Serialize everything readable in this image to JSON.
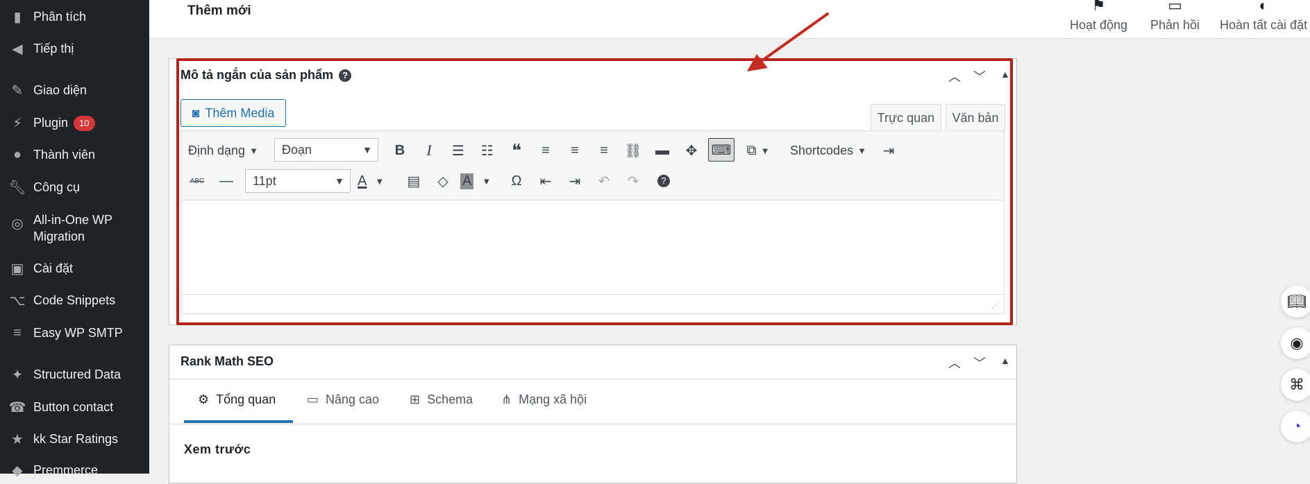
{
  "sidebar": {
    "items": [
      {
        "label": "Phân tích",
        "icon": "bar-chart-icon"
      },
      {
        "label": "Tiếp thị",
        "icon": "megaphone-icon"
      },
      {
        "label": "Giao diện",
        "icon": "paint-brush-icon"
      },
      {
        "label": "Plugin",
        "icon": "plugin-icon",
        "badge": "10"
      },
      {
        "label": "Thành viên",
        "icon": "user-icon"
      },
      {
        "label": "Công cụ",
        "icon": "wrench-icon"
      },
      {
        "label": "All-in-One WP Migration",
        "icon": "migration-icon"
      },
      {
        "label": "Cài đặt",
        "icon": "settings-icon"
      },
      {
        "label": "Code Snippets",
        "icon": "code-icon"
      },
      {
        "label": "Easy WP SMTP",
        "icon": "mail-icon"
      },
      {
        "label": "Structured Data",
        "icon": "pin-icon"
      },
      {
        "label": "Button contact",
        "icon": "phone-icon"
      },
      {
        "label": "kk Star Ratings",
        "icon": "star-icon"
      },
      {
        "label": "Premmerce",
        "icon": "cart-icon"
      }
    ]
  },
  "header": {
    "title": "Thêm mới",
    "actions": [
      {
        "label": "Hoạt động",
        "icon": "flag-icon"
      },
      {
        "label": "Phản hồi",
        "icon": "feedback-icon"
      },
      {
        "label": "Hoàn tất cài đặt",
        "icon": "progress-icon"
      }
    ]
  },
  "short_desc": {
    "title": "Mô tả ngắn của sản phẩm",
    "help": "?",
    "add_media": "Thêm Media",
    "tabs": [
      "Trực quan",
      "Văn bản"
    ],
    "toolbar": {
      "format_label": "Định dạng",
      "paragraph_select": "Đoạn",
      "shortcodes": "Shortcodes",
      "font_size": "11pt",
      "bold": "B",
      "italic": "I",
      "text_color": "A",
      "bg_color": "A",
      "omega": "Ω",
      "help": "?",
      "strike": "ABC"
    }
  },
  "rank_math": {
    "title": "Rank Math SEO",
    "tabs": [
      "Tổng quan",
      "Nâng cao",
      "Schema",
      "Mạng xã hội"
    ],
    "preview_label": "Xem trước"
  },
  "colors": {
    "sidebar_bg": "#1d2327",
    "accent": "#2271b1",
    "badge": "#d63638",
    "highlight": "#b5241b"
  }
}
